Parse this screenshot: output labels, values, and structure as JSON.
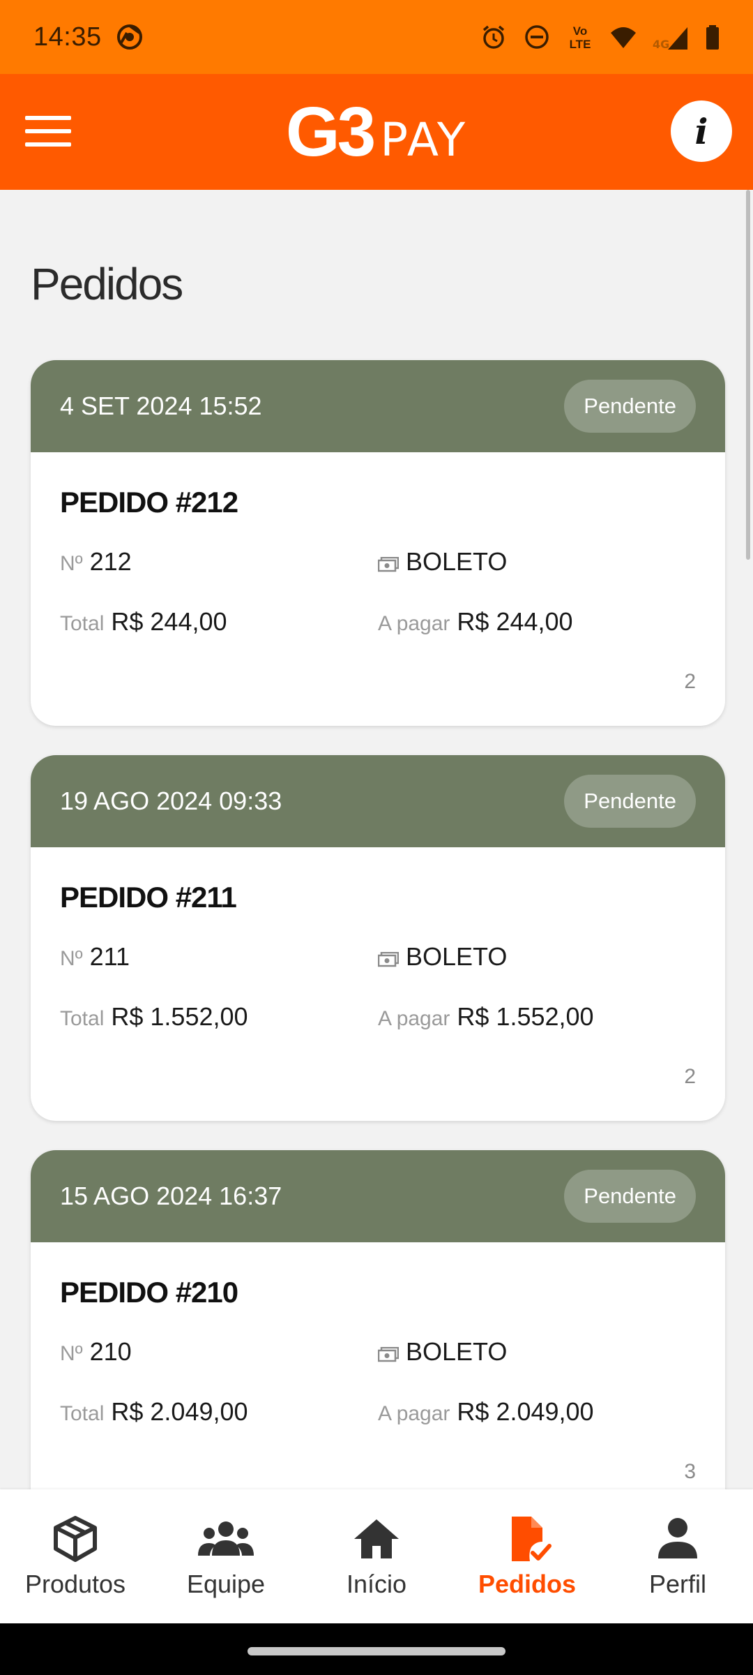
{
  "status_bar": {
    "time": "14:35",
    "icons": [
      "chrome-icon",
      "alarm-icon",
      "do-not-disturb-icon",
      "volte-icon",
      "wifi-icon",
      "signal-4g-icon",
      "battery-icon"
    ],
    "volte_label": "Vo\nLTE",
    "network_label": "4G"
  },
  "app_bar": {
    "logo_primary": "G3",
    "logo_secondary": "PAY",
    "info_label": "i",
    "background": "#ff5a00"
  },
  "page": {
    "title": "Pedidos"
  },
  "labels": {
    "number_prefix": "Nº",
    "total": "Total",
    "to_pay": "A pagar"
  },
  "orders": [
    {
      "date": "4 SET 2024 15:52",
      "status": "Pendente",
      "title": "PEDIDO #212",
      "number": "212",
      "payment_method": "BOLETO",
      "total": "R$ 244,00",
      "to_pay": "R$ 244,00",
      "count": "2"
    },
    {
      "date": "19 AGO 2024 09:33",
      "status": "Pendente",
      "title": "PEDIDO #211",
      "number": "211",
      "payment_method": "BOLETO",
      "total": "R$ 1.552,00",
      "to_pay": "R$ 1.552,00",
      "count": "2"
    },
    {
      "date": "15 AGO 2024 16:37",
      "status": "Pendente",
      "title": "PEDIDO #210",
      "number": "210",
      "payment_method": "BOLETO",
      "total": "R$ 2.049,00",
      "to_pay": "R$ 2.049,00",
      "count": "3"
    }
  ],
  "bottom_nav": [
    {
      "label": "Produtos",
      "icon": "box-icon",
      "active": false
    },
    {
      "label": "Equipe",
      "icon": "team-icon",
      "active": false
    },
    {
      "label": "Início",
      "icon": "home-icon",
      "active": false
    },
    {
      "label": "Pedidos",
      "icon": "order-document-icon",
      "active": true
    },
    {
      "label": "Perfil",
      "icon": "profile-icon",
      "active": false
    }
  ],
  "colors": {
    "status_bar": "#ff7a00",
    "accent": "#ff4d00",
    "card_header": "#6f7c62",
    "badge": "#8f9a86"
  }
}
